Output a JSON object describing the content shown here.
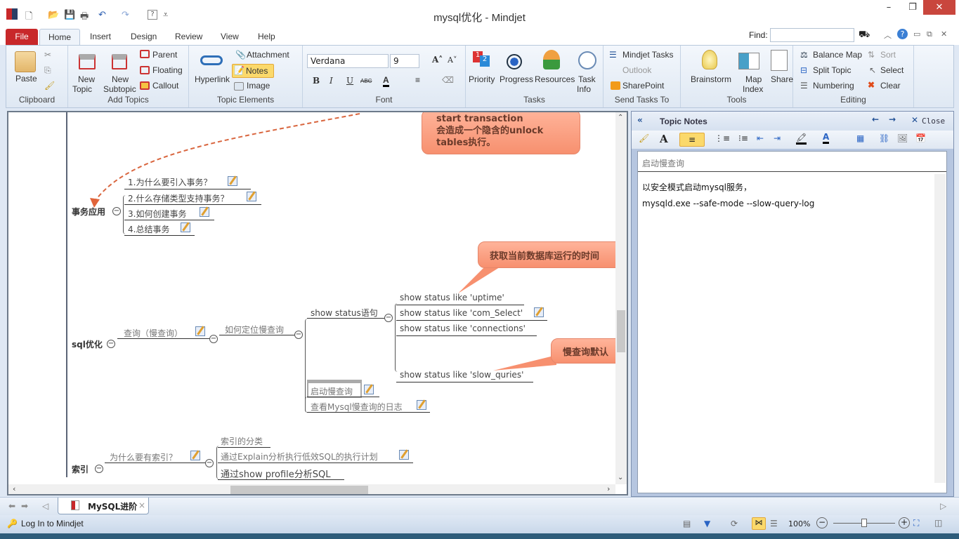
{
  "window": {
    "title": "mysql优化 - Mindjet",
    "controls": {
      "minimize": "–",
      "restore": "❐",
      "close": "✕"
    }
  },
  "quick_access": [
    "app-logo-icon",
    "new-icon",
    "open-icon",
    "save-icon",
    "print-icon",
    "undo-icon",
    "redo-icon",
    "help-icon",
    "customize-icon"
  ],
  "tabs": {
    "file": "File",
    "items": [
      "Home",
      "Insert",
      "Design",
      "Review",
      "View",
      "Help"
    ],
    "active": "Home"
  },
  "find": {
    "label": "Find:",
    "value": ""
  },
  "ribbon": {
    "clipboard": {
      "label": "Clipboard",
      "paste": "Paste"
    },
    "add_topics": {
      "label": "Add Topics",
      "new_topic": "New\nTopic",
      "new_topic_1": "New",
      "new_topic_2": "Topic",
      "new_subtopic_1": "New",
      "new_subtopic_2": "Subtopic",
      "parent": "Parent",
      "floating": "Floating",
      "callout": "Callout"
    },
    "topic_elements": {
      "label": "Topic Elements",
      "hyperlink": "Hyperlink",
      "attachment": "Attachment",
      "notes": "Notes",
      "image": "Image"
    },
    "font": {
      "label": "Font",
      "family": "Verdana",
      "size": "9",
      "bold": "B",
      "italic": "I",
      "underline": "U",
      "strike": "ABC"
    },
    "tasks": {
      "label": "Tasks",
      "priority": "Priority",
      "progress": "Progress",
      "resources": "Resources",
      "task_info_1": "Task",
      "task_info_2": "Info"
    },
    "send_tasks": {
      "label": "Send Tasks To",
      "mindjet_tasks": "Mindjet Tasks",
      "outlook": "Outlook",
      "sharepoint": "SharePoint"
    },
    "tools": {
      "label": "Tools",
      "brainstorm": "Brainstorm",
      "map_index_1": "Map",
      "map_index_2": "Index",
      "share": "Share"
    },
    "editing": {
      "label": "Editing",
      "balance_map": "Balance Map",
      "sort": "Sort",
      "split_topic": "Split Topic",
      "select": "Select",
      "numbering": "Numbering",
      "clear": "Clear"
    }
  },
  "map": {
    "callout1": {
      "line1": "start transaction",
      "line2": "会造成一个隐含的unlock",
      "line3": "tables执行。"
    },
    "transaction": {
      "label": "事务应用",
      "children": [
        "1.为什么要引入事务？",
        "2.什么存储类型支持事务？",
        "3.如何创建事务",
        "4.总结事务"
      ]
    },
    "callout2": "获取当前数据库运行的时间",
    "callout3": "慢查询默认",
    "sql": {
      "label": "sql优化",
      "query": "查询（慢查询）",
      "locate": "如何定位慢查询",
      "show_status": "show status语句",
      "status_items": [
        "show status like 'uptime'",
        "show status like 'com_Select'",
        "show status like 'connections'",
        "show status like 'slow_quries'"
      ],
      "start_slow": "启动慢查询",
      "view_log": "查看Mysql慢查询的日志"
    },
    "index": {
      "label": "索引",
      "why": "为什么要有索引？",
      "children": [
        "索引的分类",
        "通过Explain分析执行低效SQL的执行计划",
        "通过show profile分析SQL"
      ]
    }
  },
  "notes_panel": {
    "title": "Topic Notes",
    "close": "Close",
    "topic": "启动慢查询",
    "lines": [
      "以安全模式启动mysql服务，",
      "mysqld.exe --safe-mode --slow-query-log"
    ]
  },
  "doc_tabs": [
    {
      "label": "MySQL进阶",
      "close": "×"
    }
  ],
  "status": {
    "login": "Log In to Mindjet",
    "zoom": "100%",
    "zoom_level": 0.5
  }
}
